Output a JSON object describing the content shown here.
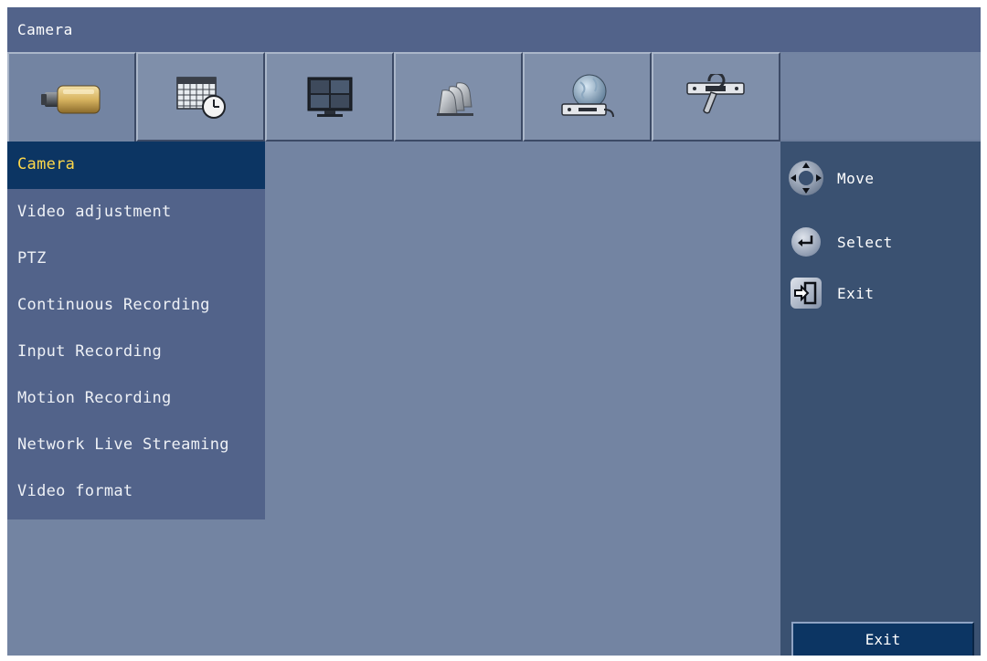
{
  "window": {
    "title": "Camera"
  },
  "tabs": [
    {
      "name": "camera",
      "icon": "camera-icon"
    },
    {
      "name": "schedule",
      "icon": "calendar-clock-icon"
    },
    {
      "name": "display",
      "icon": "monitor-icon"
    },
    {
      "name": "alarm",
      "icon": "alarm-bells-icon"
    },
    {
      "name": "network",
      "icon": "network-globe-icon"
    },
    {
      "name": "system",
      "icon": "wrench-device-icon"
    }
  ],
  "menu": {
    "items": [
      {
        "label": "Camera",
        "active": true
      },
      {
        "label": "Video adjustment"
      },
      {
        "label": "PTZ"
      },
      {
        "label": "Continuous Recording"
      },
      {
        "label": "Input Recording"
      },
      {
        "label": "Motion Recording"
      },
      {
        "label": "Network Live Streaming"
      },
      {
        "label": "Video format"
      }
    ]
  },
  "hints": {
    "move": "Move",
    "select": "Select",
    "exit": "Exit"
  },
  "exit_button": {
    "label": "Exit"
  },
  "colors": {
    "titlebar": "#52638a",
    "content": "#7384a2",
    "menu": "#52638a",
    "menu_active": "#0c3563",
    "menu_active_text": "#ffd84a",
    "right_panel": "#3a5171"
  }
}
